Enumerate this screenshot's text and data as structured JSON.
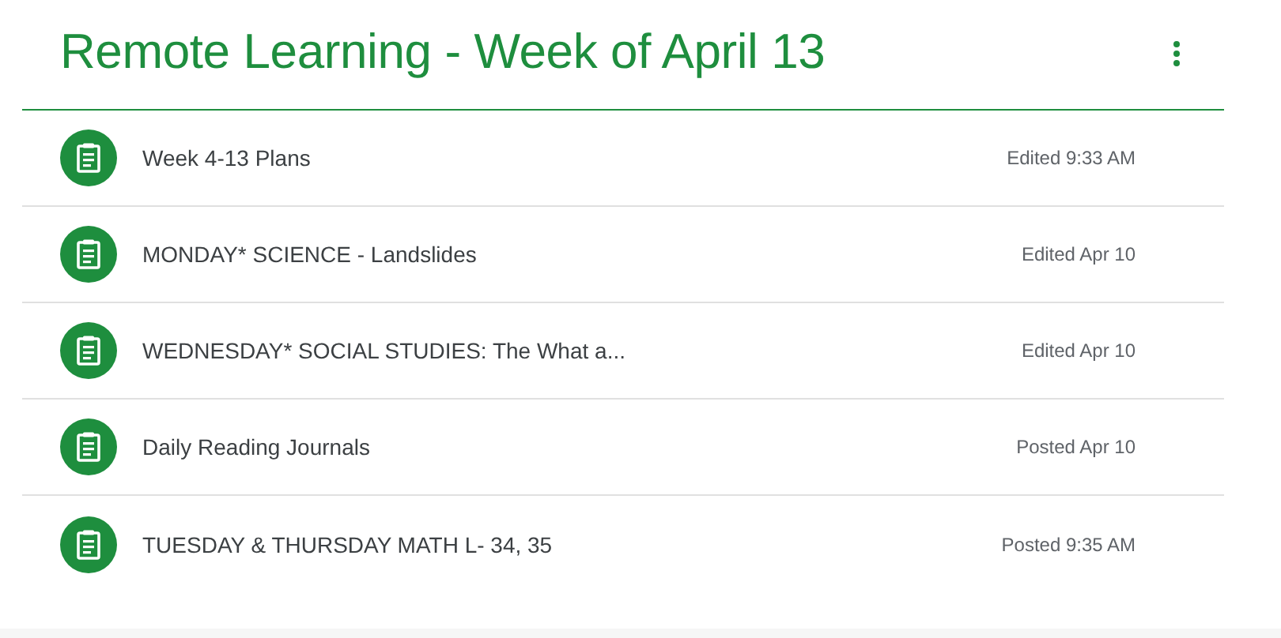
{
  "header": {
    "title": "Remote Learning - Week of April 13"
  },
  "items": [
    {
      "kind": "assignment",
      "title": "Week 4-13 Plans",
      "status": "Edited 9:33 AM"
    },
    {
      "kind": "assignment",
      "title": "MONDAY* SCIENCE - Landslides",
      "status": "Edited Apr 10"
    },
    {
      "kind": "assignment",
      "title": "WEDNESDAY* SOCIAL STUDIES: The What a...",
      "status": "Edited Apr 10"
    },
    {
      "kind": "assignment",
      "title": "Daily Reading Journals",
      "status": "Posted Apr 10"
    },
    {
      "kind": "assignment",
      "title": "TUESDAY & THURSDAY MATH L- 34, 35",
      "status": "Posted 9:35 AM"
    }
  ]
}
